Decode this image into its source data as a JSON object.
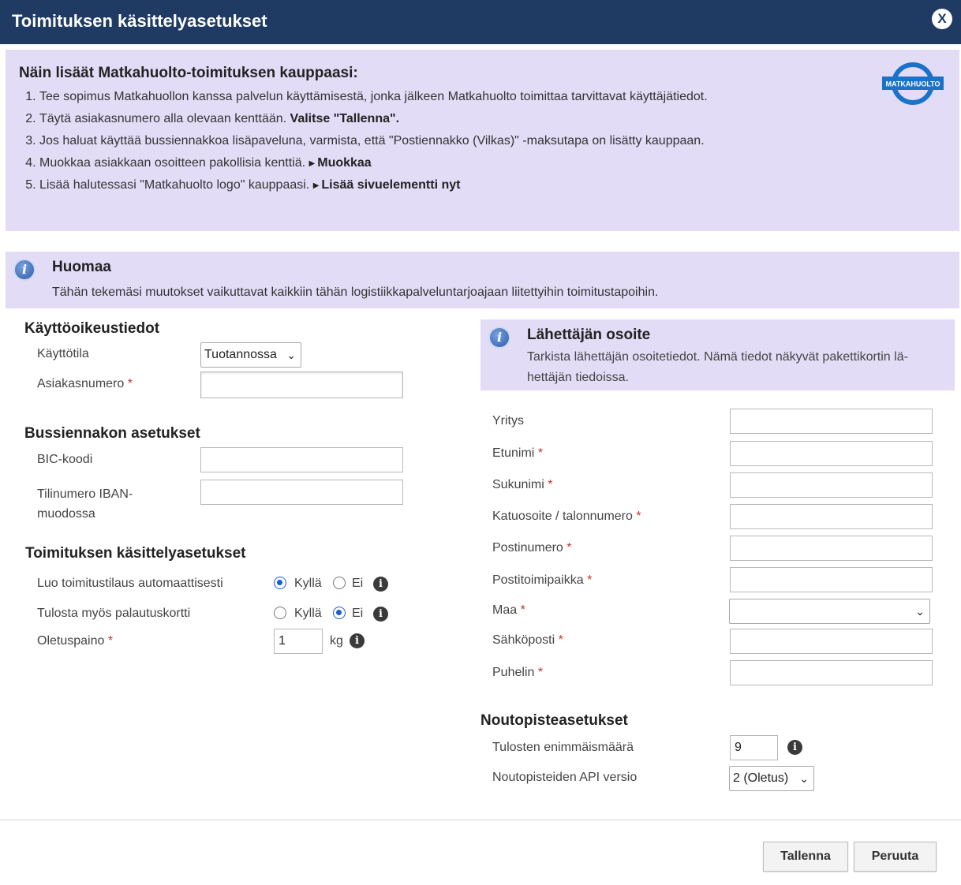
{
  "dialog": {
    "title": "Toimituksen käsittelyasetukset",
    "close_label": "X"
  },
  "instructions": {
    "heading": "Näin lisäät Matkahuolto-toimituksen kauppaasi:",
    "step1": "Tee sopimus Matkahuollon kanssa palvelun käyttämisestä, jonka jälkeen Matkahuolto toimittaa tarvittavat käyttäjätiedot.",
    "step2_text": "Täytä asiakasnumero alla olevaan kenttään. ",
    "step2_strong": "Valitse \"Tallenna\".",
    "step3": "Jos haluat käyttää bussiennakkoa lisäpaveluna, varmista, että \"Postiennakko (Vilkas)\" -maksutapa on lisätty kauppaan.",
    "step4_text": "Muokkaa asiakkaan osoitteen pakollisia kenttiä. ",
    "step4_link": "Muokkaa",
    "step5_text": "Lisää halutessasi \"Matkahuolto logo\" kauppaasi. ",
    "step5_link": "Lisää sivuelementti nyt",
    "logo_text": "MATKAHUOLTO"
  },
  "notice": {
    "title": "Huomaa",
    "text": "Tähän tekemäsi muutokset vaikuttavat kaikkiin tähän logistiikkapalveluntarjoajaan liitettyihin toimitustapoihin."
  },
  "usage": {
    "title": "Käyttöoikeustiedot",
    "mode_label": "Käyttötila",
    "mode_value": "Tuotannossa",
    "customer_label": "Asiakasnumero",
    "required_mark": "*",
    "customer_value": ""
  },
  "cod": {
    "title": "Bussiennakon asetukset",
    "bic_label": "BIC-koodi",
    "iban_label_1": "Tilinumero IBAN-",
    "iban_label_2": "muodossa"
  },
  "handling": {
    "title": "Toimituksen käsittelyasetukset",
    "auto_label": "Luo toimitustilaus automaattisesti",
    "auto_selected": "Kyllä",
    "return_label": "Tulosta myös palautuskortti",
    "return_selected": "Ei",
    "yes": "Kyllä",
    "no": "Ei",
    "weight_label": "Oletuspaino",
    "weight_value": "1",
    "weight_unit": "kg"
  },
  "sender": {
    "title": "Lähettäjän osoite",
    "text": "Tarkista lähettäjän osoitetiedot. Nämä tiedot näkyvät pakettikortin lä- hettäjän tiedoissa.",
    "company": "Yritys",
    "firstname": "Etunimi",
    "lastname": "Sukunimi",
    "street": "Katuosoite / talonnumero",
    "zip": "Postinumero",
    "city": "Postitoimipaikka",
    "country": "Maa",
    "country_value": "",
    "email": "Sähköposti",
    "phone": "Puhelin"
  },
  "pickup": {
    "title": "Noutopisteasetukset",
    "max_label": "Tulosten enimmäismäärä",
    "max_value": "9",
    "api_label": "Noutopisteiden API versio",
    "api_value": "2 (Oletus)"
  },
  "footer": {
    "save": "Tallenna",
    "cancel": "Peruuta"
  },
  "colors": {
    "header": "#1f3b63",
    "panel": "#e3dcf7",
    "accent": "#1a5fd0",
    "required": "#c0392b"
  }
}
